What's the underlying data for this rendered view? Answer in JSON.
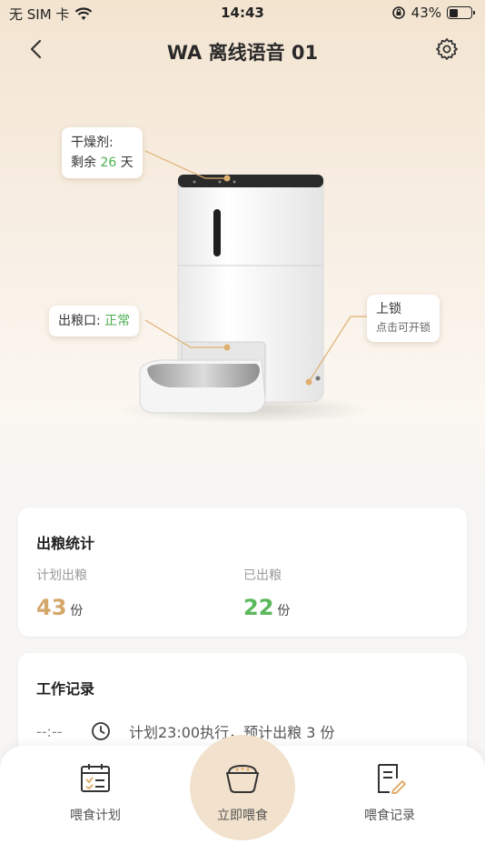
{
  "status_bar": {
    "carrier": "无 SIM 卡",
    "time": "14:43",
    "battery": "43%",
    "battery_level": 0.43
  },
  "nav": {
    "title": "WA 离线语音 01",
    "back_icon": "chevron-left-icon",
    "settings_icon": "gear-icon"
  },
  "device": {
    "desiccant": {
      "label": "干燥剂:",
      "prefix": "剩余",
      "days": "26",
      "suffix": "天"
    },
    "outlet": {
      "label": "出粮口:",
      "status": "正常"
    },
    "lock": {
      "title": "上锁",
      "hint": "点击可开锁"
    }
  },
  "stats": {
    "title": "出粮统计",
    "planned_label": "计划出粮",
    "planned_value": "43",
    "dispensed_label": "已出粮",
    "dispensed_value": "22",
    "unit": "份"
  },
  "work_log": {
    "title": "工作记录",
    "time": "--:--",
    "entry": "计划23:00执行，预计出粮 3 份"
  },
  "tabbar": {
    "plan": "喂食计划",
    "feed_now": "立即喂食",
    "records": "喂食记录"
  },
  "colors": {
    "accent_gold": "#d4a76a",
    "green": "#4caf50",
    "callout_line": "#e0b070"
  }
}
